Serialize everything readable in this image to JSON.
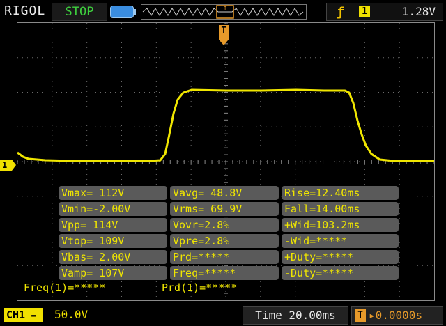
{
  "header": {
    "brand": "RIGOL",
    "run_status": "STOP",
    "trigger_edge_symbol": "ƒ",
    "trigger_channel": "1",
    "trigger_level": "1.28V",
    "trigger_marker_letter": "T"
  },
  "channel_marker": "1",
  "measurements": [
    [
      "Vmax= 112V",
      "Vavg= 48.8V",
      "Rise=12.40ms"
    ],
    [
      "Vmin=-2.00V",
      "Vrms= 69.9V",
      "Fall=14.00ms"
    ],
    [
      "Vpp= 114V",
      "Vovr=2.8%",
      "+Wid=103.2ms"
    ],
    [
      "Vtop= 109V",
      "Vpre=2.8%",
      "-Wid=*****"
    ],
    [
      "Vbas= 2.00V",
      "Prd=*****",
      "+Duty=*****"
    ],
    [
      "Vamp= 107V",
      "Freq=*****",
      "-Duty=*****"
    ]
  ],
  "counters": {
    "freq": "Freq(1)=*****",
    "period": "Prd(1)=*****"
  },
  "footer": {
    "channel": "CH1",
    "volts_per_div": "50.0V",
    "timebase": "Time 20.00ms",
    "trigger_offset": "0.0000s"
  },
  "colors": {
    "trace": "#f0e600",
    "trigger": "#e79a2a",
    "status": "#3ecf3e",
    "grid": "#5a5a5a"
  }
}
